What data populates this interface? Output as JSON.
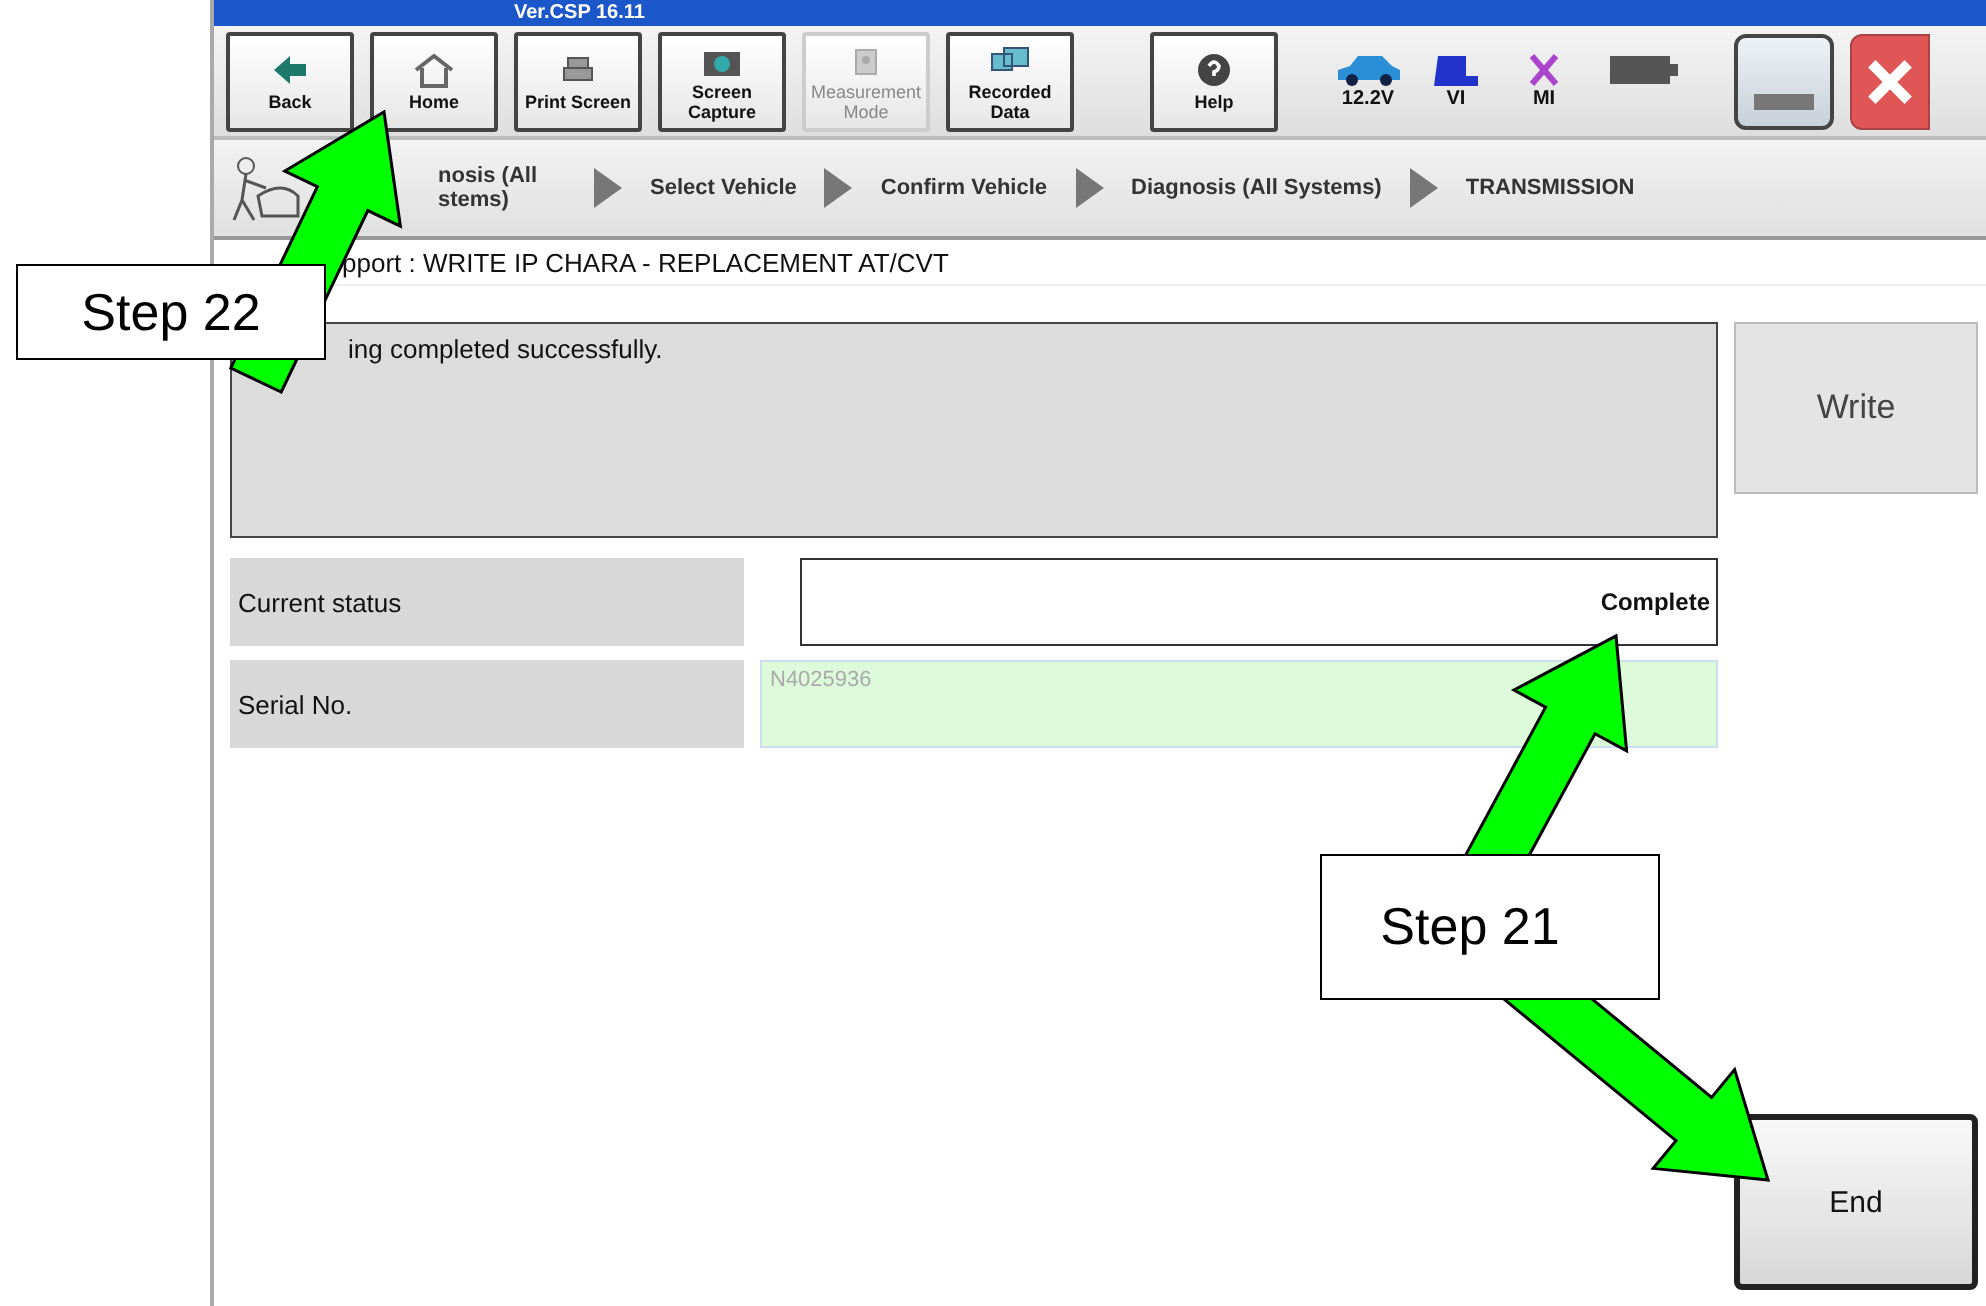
{
  "window": {
    "title": "Ver.CSP 16.11"
  },
  "toolbar": [
    {
      "label": "Back",
      "kind": "back",
      "disabled": false
    },
    {
      "label": "Home",
      "kind": "home",
      "disabled": false
    },
    {
      "label": "Print Screen",
      "kind": "print",
      "disabled": false
    },
    {
      "label": "Screen Capture",
      "kind": "camera",
      "disabled": false
    },
    {
      "label": "Measurement Mode",
      "kind": "measure",
      "disabled": true
    },
    {
      "label": "Recorded Data",
      "kind": "recorded",
      "disabled": false
    },
    {
      "label": "Help",
      "kind": "help",
      "disabled": false
    }
  ],
  "status_icons": [
    {
      "label": "12.2V",
      "kind": "car"
    },
    {
      "label": "VI",
      "kind": "vi"
    },
    {
      "label": "MI",
      "kind": "mi"
    }
  ],
  "breadcrumbs": [
    "nosis (All stems)",
    "Select Vehicle",
    "Confirm Vehicle",
    "Diagnosis (All Systems)",
    "TRANSMISSION"
  ],
  "page_title": "pport : WRITE IP CHARA - REPLACEMENT AT/CVT",
  "message": "ing completed successfully.",
  "write_button": "Write",
  "fields": [
    {
      "label": "Current status",
      "value": "Complete",
      "kind": "status"
    },
    {
      "label": "Serial No.",
      "value": "N4025936",
      "kind": "serial"
    }
  ],
  "end_button": "End",
  "callouts": [
    {
      "label": "Step 22"
    },
    {
      "label": "Step 21"
    }
  ]
}
